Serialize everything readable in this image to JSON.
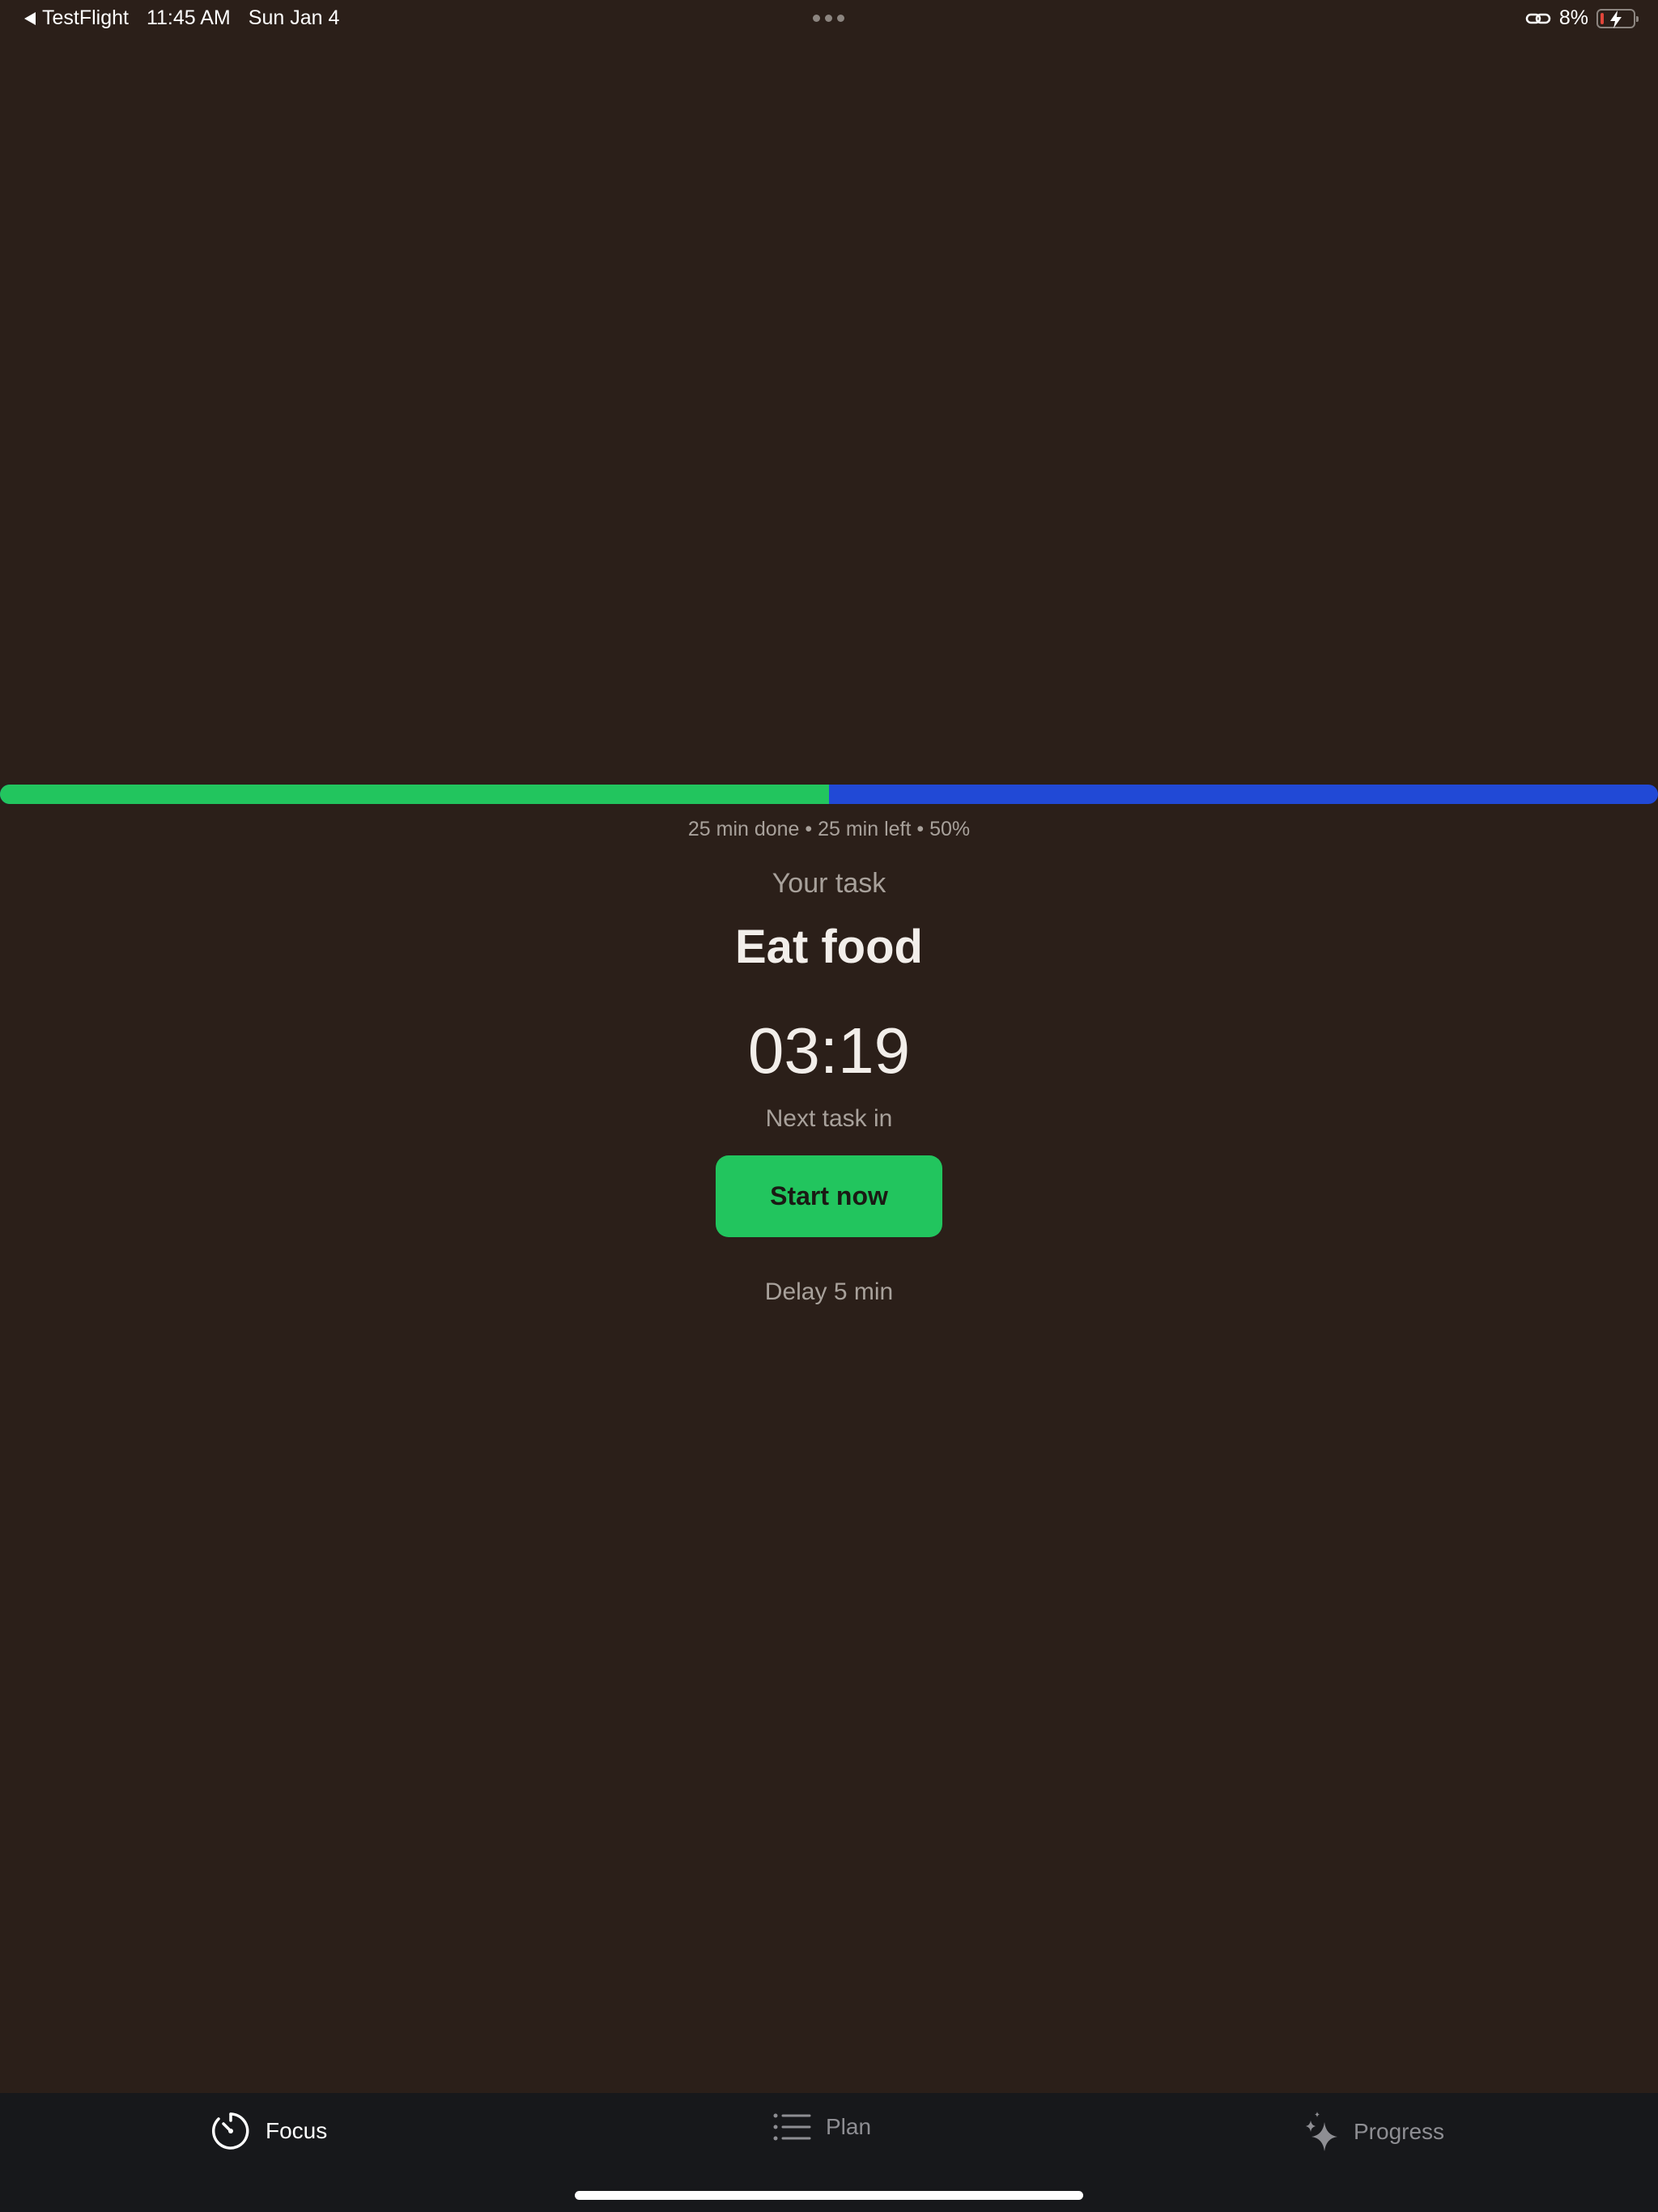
{
  "status_bar": {
    "back_app": "TestFlight",
    "time": "11:45 AM",
    "date": "Sun Jan 4",
    "battery_percent": "8%",
    "battery_level": 0.08,
    "charging": true
  },
  "progress": {
    "text": "25 min done • 25 min left • 50%",
    "fraction": 0.5,
    "done_color": "#22c55e",
    "left_color": "#2149d6"
  },
  "task": {
    "caption": "Your task",
    "name": "Eat food",
    "timer": "03:19",
    "next_caption": "Next task in"
  },
  "actions": {
    "start_label": "Start now",
    "delay_label": "Delay 5 min"
  },
  "tabs": [
    {
      "label": "Focus",
      "icon": "timer-icon",
      "active": true
    },
    {
      "label": "Plan",
      "icon": "list-icon",
      "active": false
    },
    {
      "label": "Progress",
      "icon": "sparkle-icon",
      "active": false
    }
  ],
  "colors": {
    "background": "#2b1f19",
    "tab_bar": "#17181b",
    "accent": "#22c55e"
  }
}
